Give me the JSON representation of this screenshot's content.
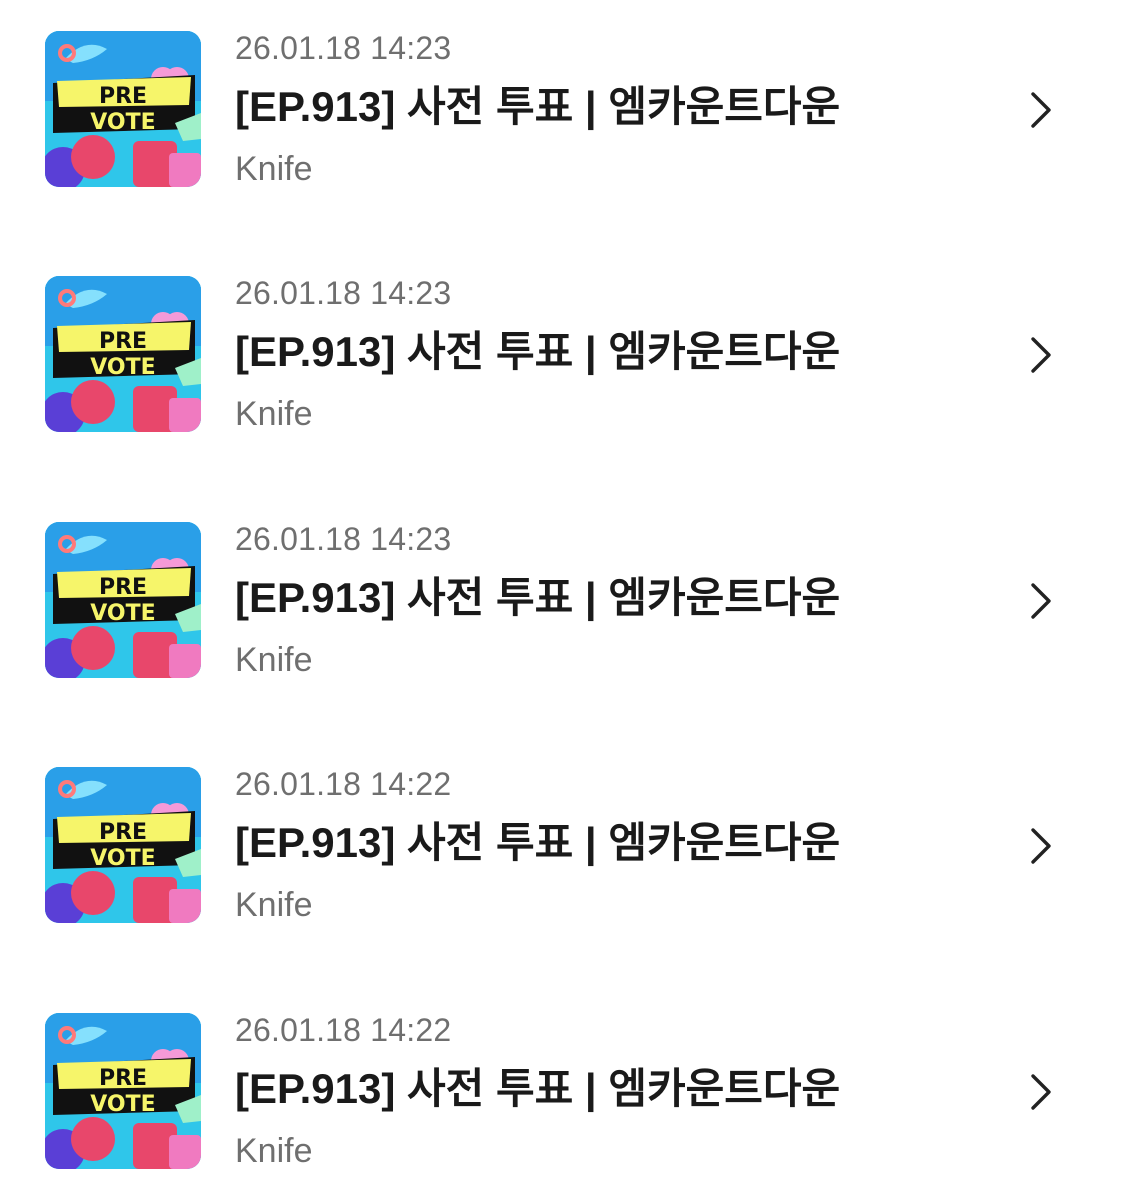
{
  "items": [
    {
      "thumbnail": {
        "line1": "PRE",
        "line2": "VOTE"
      },
      "time": "26.01.18 14:23",
      "title": "[EP.913] 사전 투표 | 엠카운트다운",
      "author": "Knife",
      "icon": "chevron-right-icon"
    },
    {
      "thumbnail": {
        "line1": "PRE",
        "line2": "VOTE"
      },
      "time": "26.01.18 14:23",
      "title": "[EP.913] 사전 투표 | 엠카운트다운",
      "author": "Knife",
      "icon": "chevron-right-icon"
    },
    {
      "thumbnail": {
        "line1": "PRE",
        "line2": "VOTE"
      },
      "time": "26.01.18 14:23",
      "title": "[EP.913] 사전 투표 | 엠카운트다운",
      "author": "Knife",
      "icon": "chevron-right-icon"
    },
    {
      "thumbnail": {
        "line1": "PRE",
        "line2": "VOTE"
      },
      "time": "26.01.18 14:22",
      "title": "[EP.913] 사전 투표 | 엠카운트다운",
      "author": "Knife",
      "icon": "chevron-right-icon"
    },
    {
      "thumbnail": {
        "line1": "PRE",
        "line2": "VOTE"
      },
      "time": "26.01.18 14:22",
      "title": "[EP.913] 사전 투표 | 엠카운트다운",
      "author": "Knife",
      "icon": "chevron-right-icon"
    }
  ],
  "colors": {
    "thumbnail_bg": "#2ec8e8",
    "banner_yellow": "#f6f56a",
    "banner_black": "#111111",
    "heart_pink": "#f59ad8",
    "ball_red": "#e8476b",
    "ball_purple": "#5a3fd6",
    "time_text": "#6f6f6f",
    "title_text": "#1a1a1a",
    "chevron": "#222222"
  }
}
